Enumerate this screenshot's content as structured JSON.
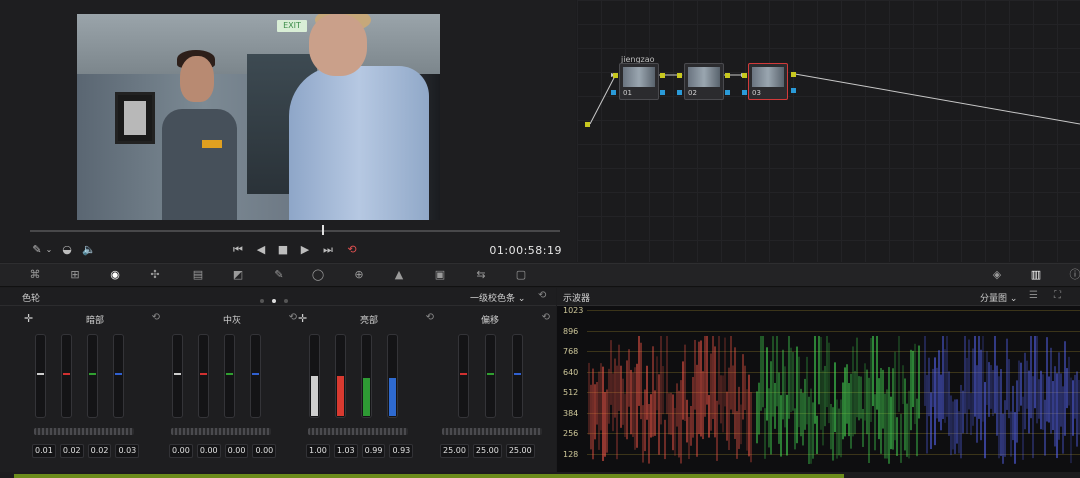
{
  "viewer": {
    "exit_sign": "EXIT",
    "timecode": "01:00:58:19",
    "playhead_fraction": 0.55
  },
  "node_editor": {
    "node_label": "jiengzao",
    "nodes": [
      {
        "id": "01",
        "active": false
      },
      {
        "id": "02",
        "active": false
      },
      {
        "id": "03",
        "active": true
      }
    ],
    "colors": {
      "input_port": "#c8c820",
      "output_port": "#2a9ad8",
      "link": "#c8c8c8",
      "active_border": "#d23a3a"
    }
  },
  "wheels": {
    "title": "色轮",
    "mode": "一级校色条",
    "page_dot_active": 1,
    "groups": [
      {
        "label": "暗部",
        "values": [
          "0.01",
          "0.02",
          "0.02",
          "0.03"
        ]
      },
      {
        "label": "中灰",
        "values": [
          "0.00",
          "0.00",
          "0.00",
          "0.00"
        ]
      },
      {
        "label": "亮部",
        "values": [
          "1.00",
          "1.03",
          "0.99",
          "0.93"
        ]
      },
      {
        "label": "偏移",
        "values": [
          "25.00",
          "25.00",
          "25.00"
        ]
      }
    ]
  },
  "scope": {
    "title": "示波器",
    "mode": "分量图",
    "y_labels": [
      "1023",
      "896",
      "768",
      "640",
      "512",
      "384",
      "256",
      "128"
    ]
  }
}
